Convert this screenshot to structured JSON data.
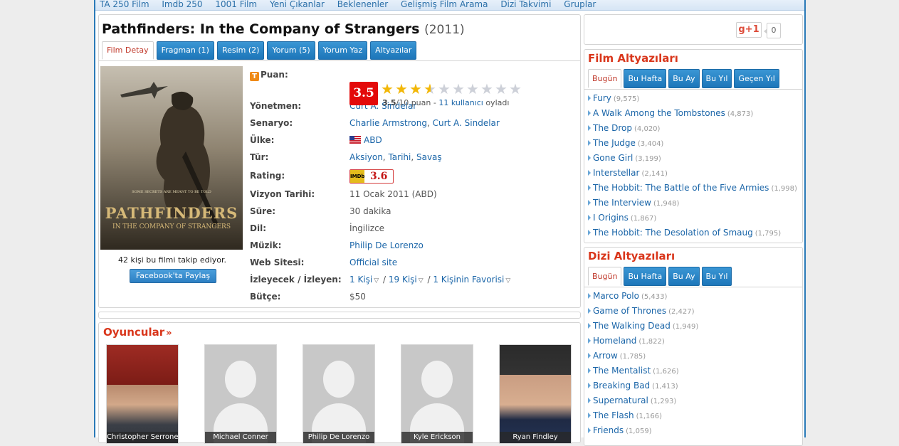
{
  "topnav": [
    "TA 250 Film",
    "Imdb 250",
    "1001 Film",
    "Yeni Çıkanlar",
    "Beklenenler",
    "Gelişmiş Film Arama",
    "Dizi Takvimi",
    "Gruplar"
  ],
  "film": {
    "title": "Pathfinders: In the Company of Strangers",
    "year": "(2011)",
    "tabs": [
      "Film Detay",
      "Fragman (1)",
      "Resim (2)",
      "Yorum (5)",
      "Yorum Yaz",
      "Altyazılar"
    ],
    "poster": {
      "tagline": "SOME SECRETS ARE MEANT TO BE TOLD",
      "title_line1": "PATHFINDERS",
      "title_line2": "IN THE COMPANY OF STRANGERS"
    },
    "follow_text": "42 kişi bu filmi takip ediyor.",
    "facebook_share": "Facebook'ta Paylaş",
    "puan_label": "Puan:",
    "score": "3.5",
    "rating_value": 3.5,
    "rating_max": 10,
    "rating_text_score": "3.5",
    "rating_text_suffix": "/10 puan - ",
    "rating_text_users": "11 kullanıcı",
    "rating_text_end": " oyladı",
    "director_label": "Yönetmen:",
    "director": "Curt A. Sindelar",
    "writers_label": "Senaryo:",
    "writers": [
      "Charlie Armstrong",
      "Curt A. Sindelar"
    ],
    "country_label": "Ülke:",
    "country": "ABD",
    "genre_label": "Tür:",
    "genres": [
      "Aksiyon",
      "Tarihi",
      "Savaş"
    ],
    "rating_label": "Rating:",
    "imdb_logo": "IMDb",
    "imdb_rating": "3.6",
    "release_label": "Vizyon Tarihi:",
    "release": "11 Ocak 2011 (ABD)",
    "duration_label": "Süre:",
    "duration": "30 dakika",
    "language_label": "Dil:",
    "language": "İngilizce",
    "music_label": "Müzik:",
    "music": "Philip De Lorenzo",
    "website_label": "Web Sitesi:",
    "website": "Official site",
    "watch_label": "İzleyecek / İzleyen:",
    "watch_will": "1 Kişi",
    "watch_did": "19 Kişi",
    "watch_fav": "1 Kişinin Favorisi",
    "budget_label": "Bütçe:",
    "budget": "$50"
  },
  "cast": {
    "title": "Oyuncular",
    "actors": [
      "Christopher Serrone",
      "Michael Conner",
      "Philip De Lorenzo",
      "Kyle Erickson",
      "Ryan Findley"
    ]
  },
  "gplus": {
    "label": "g+1",
    "count": "0"
  },
  "film_subs": {
    "title": "Film Altyazıları",
    "tabs": [
      "Bugün",
      "Bu Hafta",
      "Bu Ay",
      "Bu Yıl",
      "Geçen Yıl"
    ],
    "items": [
      {
        "name": "Fury",
        "count": "(9,575)"
      },
      {
        "name": "A Walk Among the Tombstones",
        "count": "(4,873)"
      },
      {
        "name": "The Drop",
        "count": "(4,020)"
      },
      {
        "name": "The Judge",
        "count": "(3,404)"
      },
      {
        "name": "Gone Girl",
        "count": "(3,199)"
      },
      {
        "name": "Interstellar",
        "count": "(2,141)"
      },
      {
        "name": "The Hobbit: The Battle of the Five Armies",
        "count": "(1,998)"
      },
      {
        "name": "The Interview",
        "count": "(1,948)"
      },
      {
        "name": "I Origins",
        "count": "(1,867)"
      },
      {
        "name": "The Hobbit: The Desolation of Smaug",
        "count": "(1,795)"
      }
    ]
  },
  "dizi_subs": {
    "title": "Dizi Altyazıları",
    "tabs": [
      "Bugün",
      "Bu Hafta",
      "Bu Ay",
      "Bu Yıl"
    ],
    "items": [
      {
        "name": "Marco Polo",
        "count": "(5,433)"
      },
      {
        "name": "Game of Thrones",
        "count": "(2,427)"
      },
      {
        "name": "The Walking Dead",
        "count": "(1,949)"
      },
      {
        "name": "Homeland",
        "count": "(1,822)"
      },
      {
        "name": "Arrow",
        "count": "(1,785)"
      },
      {
        "name": "The Mentalist",
        "count": "(1,626)"
      },
      {
        "name": "Breaking Bad",
        "count": "(1,413)"
      },
      {
        "name": "Supernatural",
        "count": "(1,293)"
      },
      {
        "name": "The Flash",
        "count": "(1,166)"
      },
      {
        "name": "Friends",
        "count": "(1,059)"
      }
    ]
  }
}
